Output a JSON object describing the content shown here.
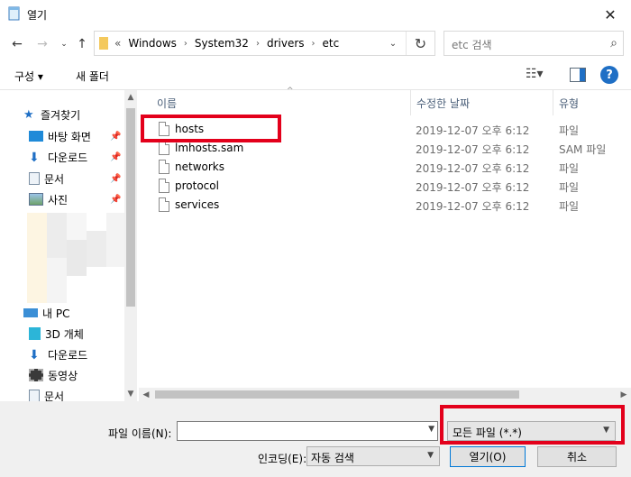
{
  "window": {
    "title": "열기"
  },
  "address": {
    "overflow": "«",
    "crumbs": [
      "Windows",
      "System32",
      "drivers",
      "etc"
    ],
    "search_placeholder": "etc 검색"
  },
  "toolbar": {
    "organize": "구성 ▾",
    "new_folder": "새 폴더"
  },
  "sidebar": {
    "quick_access": "즐겨찾기",
    "quick_items": [
      "바탕 화면",
      "다운로드",
      "문서",
      "사진"
    ],
    "this_pc": "내 PC",
    "pc_items": [
      "3D 개체",
      "다운로드",
      "동영상",
      "문서"
    ]
  },
  "columns": {
    "name": "이름",
    "date": "수정한 날짜",
    "type": "유형"
  },
  "files": [
    {
      "name": "hosts",
      "date": "2019-12-07 오후 6:12",
      "type": "파일"
    },
    {
      "name": "lmhosts.sam",
      "date": "2019-12-07 오후 6:12",
      "type": "SAM 파일"
    },
    {
      "name": "networks",
      "date": "2019-12-07 오후 6:12",
      "type": "파일"
    },
    {
      "name": "protocol",
      "date": "2019-12-07 오후 6:12",
      "type": "파일"
    },
    {
      "name": "services",
      "date": "2019-12-07 오후 6:12",
      "type": "파일"
    }
  ],
  "bottom": {
    "filename_label": "파일 이름(N):",
    "filename_value": "",
    "filetype": "모든 파일 (*.*)",
    "encoding_label": "인코딩(E):",
    "encoding_value": "자동 검색",
    "open": "열기(O)",
    "cancel": "취소"
  },
  "colors": {
    "accent": "#0078d7",
    "highlight": "#e3001b"
  }
}
